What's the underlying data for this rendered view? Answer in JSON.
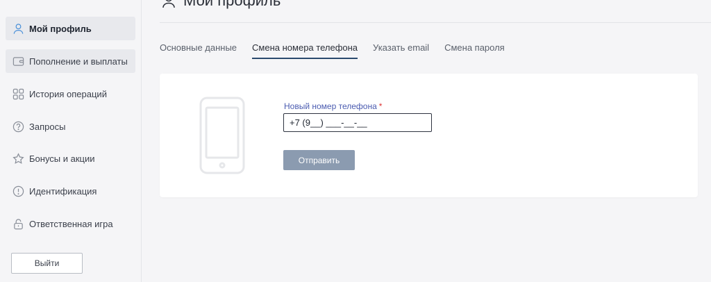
{
  "header": {
    "title": "Мой профиль",
    "icon": "user-icon"
  },
  "sidebar": {
    "items": [
      {
        "label": "Мой профиль",
        "icon": "user-icon",
        "active": true
      },
      {
        "label": "Пополнение и выплаты",
        "icon": "wallet-icon"
      },
      {
        "label": "История операций",
        "icon": "grid-icon"
      },
      {
        "label": "Запросы",
        "icon": "question-icon"
      },
      {
        "label": "Бонусы и акции",
        "icon": "star-icon"
      },
      {
        "label": "Идентификация",
        "icon": "alert-icon"
      },
      {
        "label": "Ответственная игра",
        "icon": "lock-icon"
      }
    ],
    "logout_label": "Выйти"
  },
  "tabs": [
    {
      "label": "Основные данные",
      "active": false
    },
    {
      "label": "Смена номера телефона",
      "active": true
    },
    {
      "label": "Указать email",
      "active": false
    },
    {
      "label": "Смена пароля",
      "active": false
    }
  ],
  "form": {
    "phone_label": "Новый номер телефона",
    "required_mark": "*",
    "phone_value": "+7 (9__) ___-__-__",
    "submit_label": "Отправить"
  },
  "colors": {
    "accent": "#4a90d9",
    "tab_underline": "#2b4a6e",
    "button_disabled": "#8b9bb0",
    "label": "#4a5bb0",
    "required": "#dd3333"
  }
}
